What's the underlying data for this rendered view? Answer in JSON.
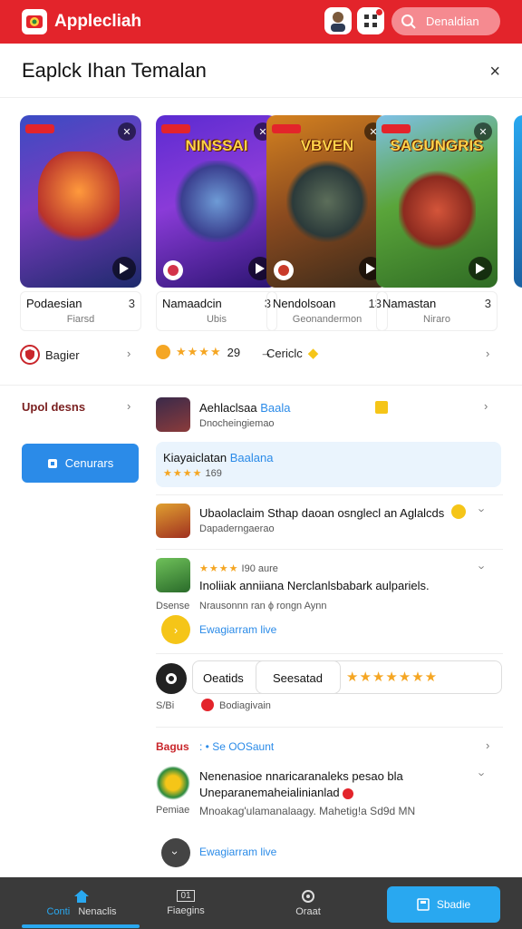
{
  "appbar": {
    "title": "Applecliah",
    "search_label": "Denaldian"
  },
  "sheet": {
    "title": "Eaplck Ihan Temalan",
    "close_symbol": "×"
  },
  "cards": [
    {
      "art_title": "",
      "name": "Podaesian",
      "num": "3",
      "sub": "Fiarsd"
    },
    {
      "art_title": "NINSSAI",
      "name": "Namaadcin",
      "num": "3",
      "sub": "Ubis"
    },
    {
      "art_title": "VBVEN",
      "name": "Nendolsoan",
      "num": "13",
      "sub": "Geonandermon"
    },
    {
      "art_title": "SAGUNGRIS",
      "name": "Namastan",
      "num": "3",
      "sub": "Niraro"
    }
  ],
  "sort_row": {
    "item1": "Bagier",
    "item2_rating": "29",
    "item2_arrow": "→",
    "item3": "Cericlc"
  },
  "left_panel": {
    "filter_label": "Upol desns",
    "button_label": "Cenurars"
  },
  "list": [
    {
      "title": "Aehlaclsaa",
      "title_accent": "Baala",
      "sub": "Dnocheingiemao"
    },
    {
      "title": "Kiayaiclatan",
      "title_accent": "Baalana",
      "rating": "169"
    },
    {
      "title": "Ubaolaclaim Sthap daoan osnglecl an Aglalcds",
      "sub": "Dapaderngaerao"
    },
    {
      "rating_label": "I90 aure",
      "title": "Inoliiak anniiana Nerclanlsbabark aulpariels.",
      "left_caption": "Dsense",
      "sub": "Nrausonnn ran ϕ rongn Aynn",
      "link": "Ewagiarram live"
    },
    {
      "pill1": "Oeatids",
      "pill2": "Seesatad",
      "left_caption": "S/Bi",
      "sub": "Bodiagivain"
    },
    {
      "tag": "Bagus",
      "tag_rest": ": • Se OOSaunt",
      "title": "Nenenasioe nnaricaranaleks pesao bla",
      "title2": "Uneparanemaheialinianlad",
      "left_caption": "Pemiae",
      "sub": "Mnoakag'ulamanalaagy. Mahetig!a Sd9d MN",
      "link": "Ewagiarram live"
    }
  ],
  "bottom_tabs": [
    {
      "label": "Conti",
      "label2": "Nenaclis"
    },
    {
      "label": "Fiaegins",
      "icon_text": "01"
    },
    {
      "label": "Oraat"
    }
  ],
  "cta_label": "Sbadie",
  "colors": {
    "brand_red": "#e3242b",
    "accent_blue": "#29a8f0",
    "btn_blue": "#2b8be8"
  }
}
